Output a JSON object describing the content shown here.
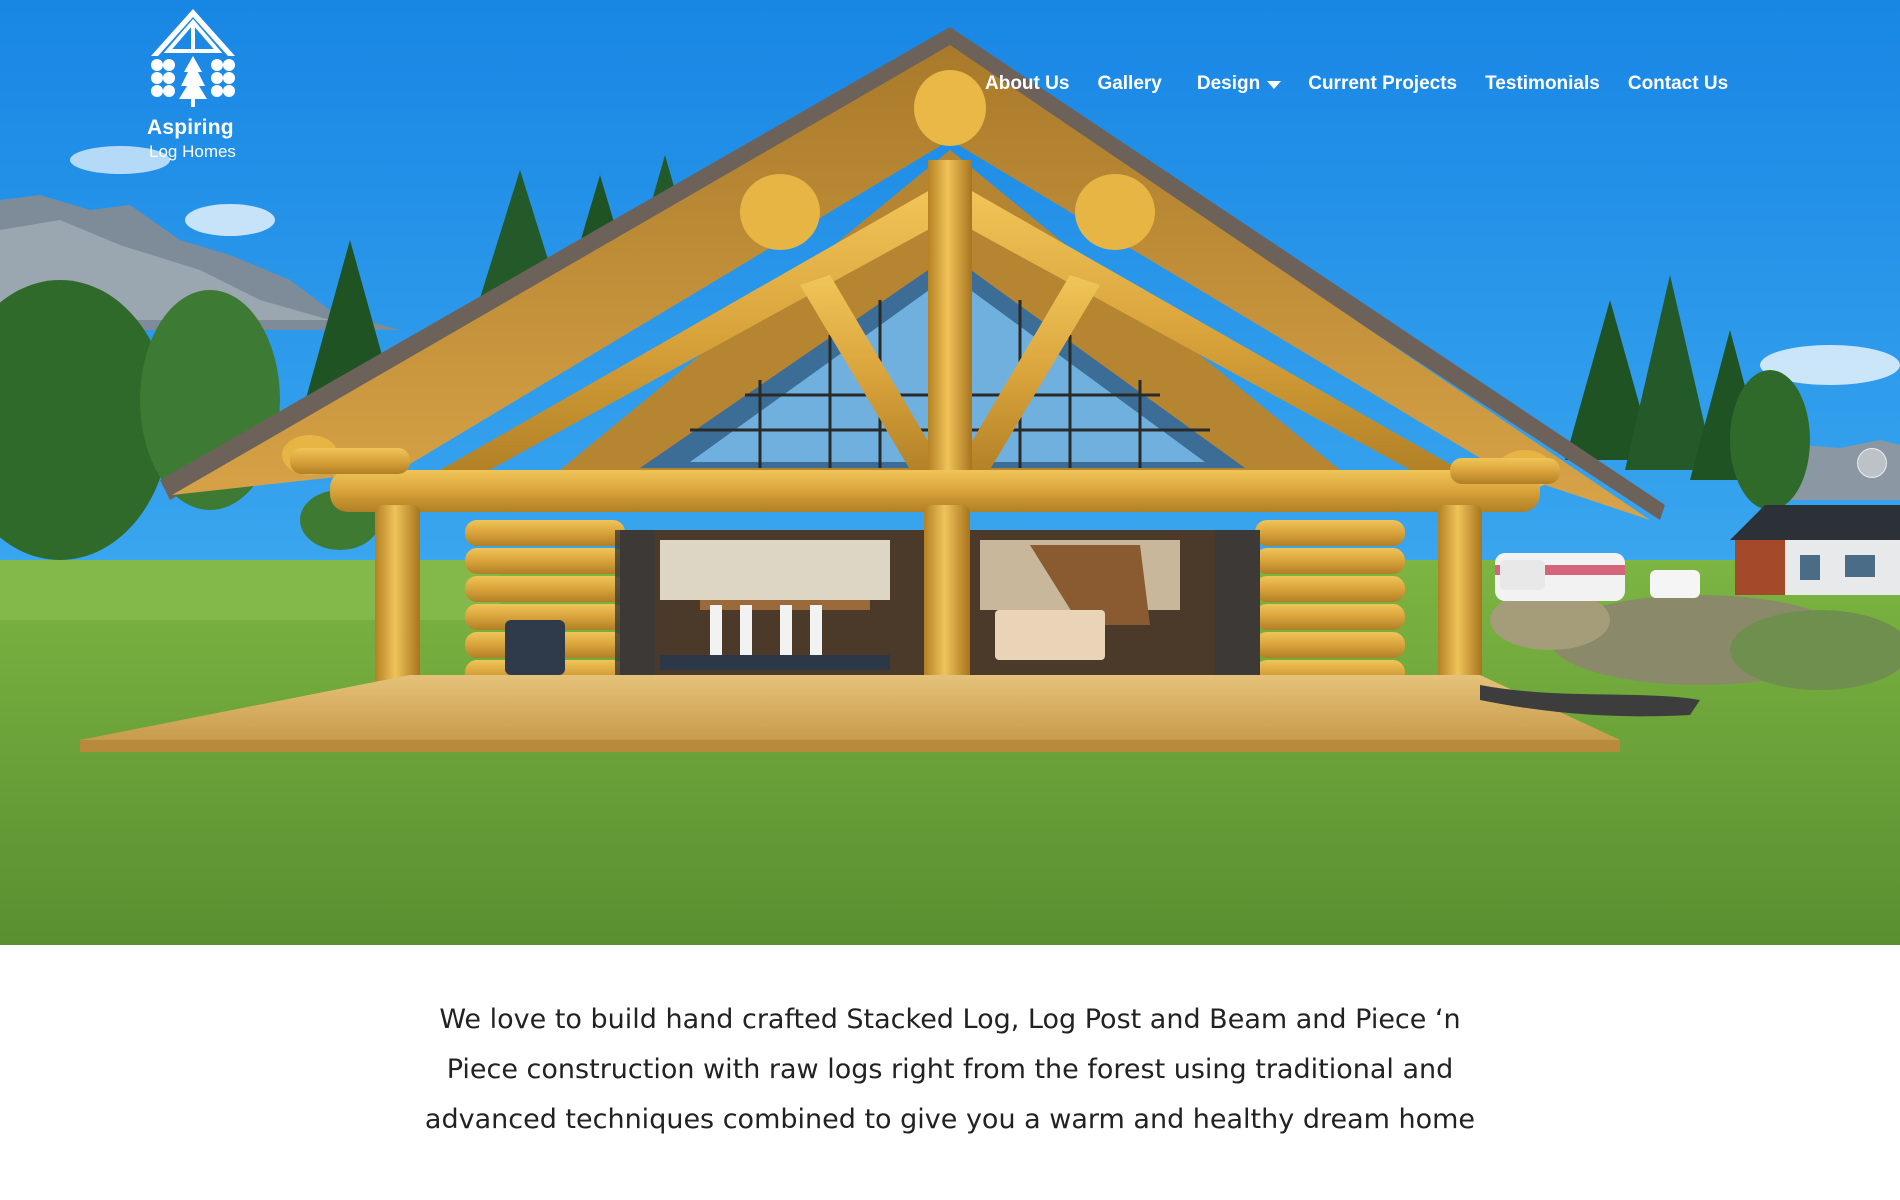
{
  "logo": {
    "name": "Aspiring",
    "tagline": "Log Homes",
    "icon": "log-cabin-logo-icon"
  },
  "nav": {
    "items": [
      {
        "label": "About Us"
      },
      {
        "label": "Gallery"
      },
      {
        "label": "Design",
        "icon": "caret-down-icon"
      },
      {
        "label": "Current Projects"
      },
      {
        "label": "Testimonials"
      },
      {
        "label": "Contact Us"
      }
    ]
  },
  "hero": {
    "image": "log-home-photo",
    "slider_control": "slider-dot"
  },
  "intro": {
    "text": "We love to build hand crafted Stacked Log, Log Post and Beam and Piece ‘n Piece construction with raw logs right from the forest using traditional and advanced techniques combined to give you a warm and healthy dream home"
  },
  "colors": {
    "sky": "#1a8ee3",
    "grass": "#6aa33a",
    "log_wood": "#d9a93c",
    "text": "#222222"
  }
}
